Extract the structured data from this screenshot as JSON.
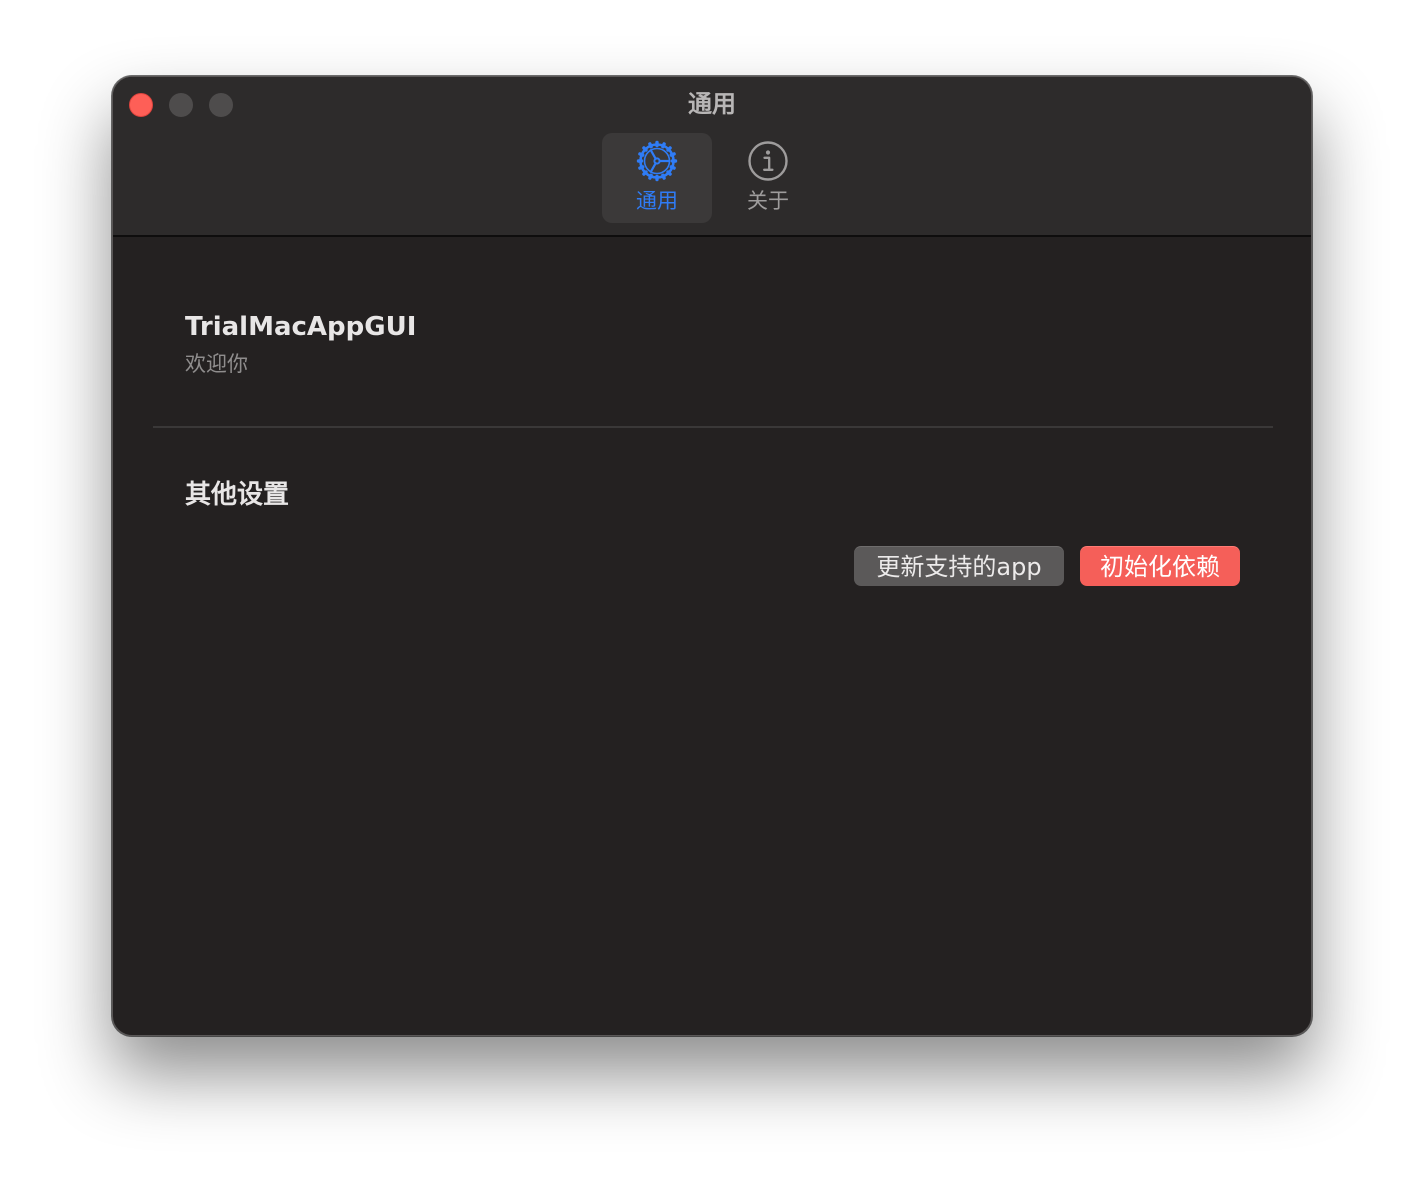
{
  "window": {
    "title": "通用",
    "controls": {
      "close": "#fe5f57",
      "minimize": "#4e4c4c",
      "maximize": "#4e4c4c"
    }
  },
  "toolbar": {
    "tabs": [
      {
        "label": "通用",
        "icon": "gear-icon",
        "selected": true,
        "color": "#2f7cf6"
      },
      {
        "label": "关于",
        "icon": "info-icon",
        "selected": false,
        "color": "#9e9c9c"
      }
    ]
  },
  "main": {
    "app_name": "TrialMacAppGUI",
    "welcome_text": "欢迎你",
    "section_title": "其他设置",
    "buttons": {
      "update_apps": "更新支持的app",
      "init_dependencies": "初始化依赖"
    }
  },
  "colors": {
    "accent": "#2f7cf6",
    "destructive": "#f55f59",
    "window_background": "#242121",
    "toolbar_background": "#2d2b2b"
  }
}
